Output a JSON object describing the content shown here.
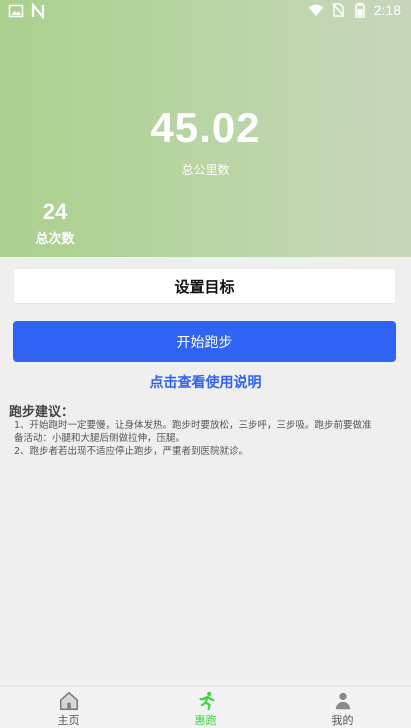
{
  "status_bar": {
    "time": "2:18",
    "left_icons": [
      "image-icon",
      "notification-n-icon"
    ],
    "right_icons": [
      "wifi-icon",
      "no-sim-icon",
      "battery-icon"
    ]
  },
  "summary": {
    "distance_value": "45.02",
    "distance_label": "总公里数",
    "runs_value": "24",
    "runs_label": "总次数"
  },
  "actions": {
    "goal_label": "设置目标",
    "start_label": "开始跑步",
    "help_link": "点击查看使用说明"
  },
  "advice": {
    "title": "跑步建议：",
    "lines": [
      "1、开始跑时一定要慢，让身体发热。跑步时要放松，三步呼，三步吸。跑步前要做准",
      "备活动：小腿和大腿后侧做拉伸，压腿。",
      "2、跑步者若出现不适应停止跑步，严重者到医院就诊。"
    ]
  },
  "tabs": [
    {
      "label": "主页",
      "icon": "home-icon",
      "active": false
    },
    {
      "label": "惠跑",
      "icon": "runner-icon",
      "active": true
    },
    {
      "label": "我的",
      "icon": "person-icon",
      "active": false
    }
  ],
  "colors": {
    "accent_blue": "#2f63f4",
    "accent_green": "#39d63b",
    "hero_gradient_start": "#a9d08e",
    "hero_gradient_end": "#c8d6bc",
    "background": "#efefef"
  }
}
